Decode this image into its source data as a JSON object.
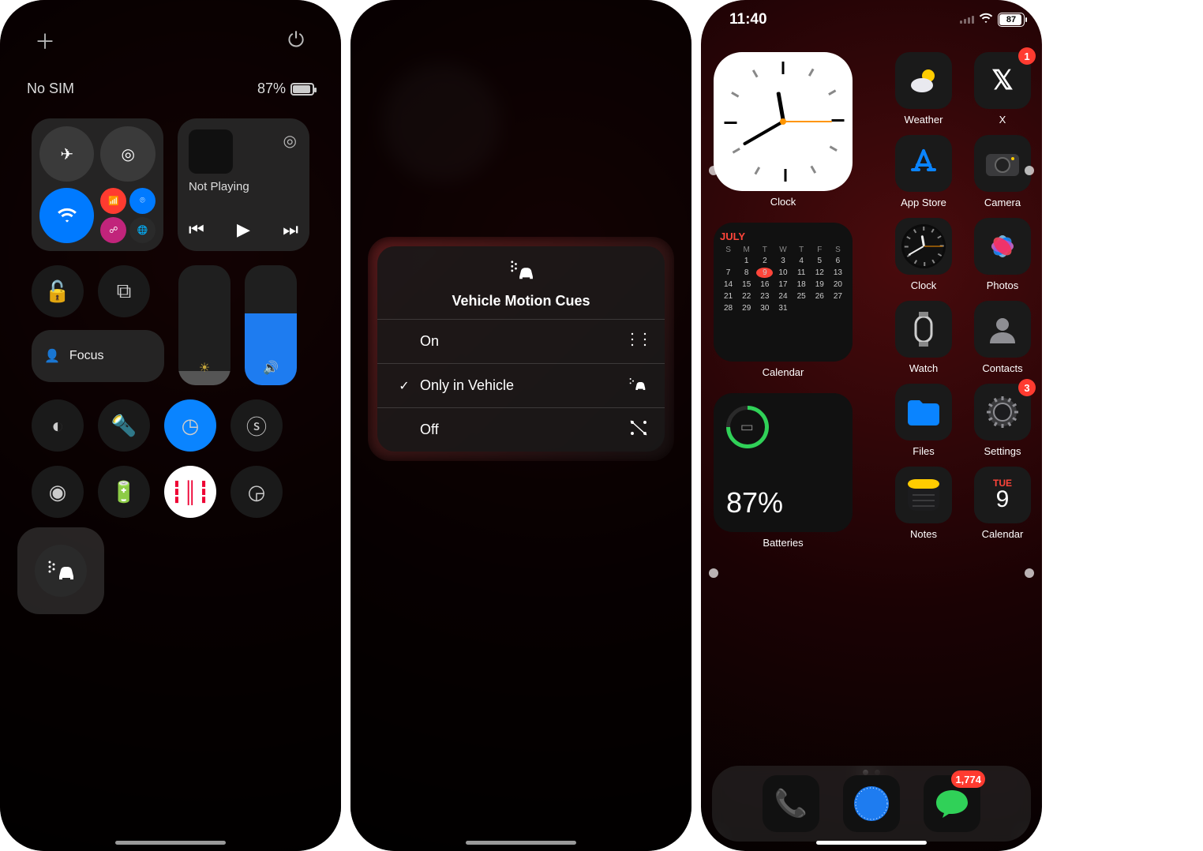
{
  "panel1": {
    "status": {
      "carrier": "No SIM",
      "battery_text": "87%"
    },
    "media": {
      "title": "Not Playing"
    },
    "focus_label": "Focus"
  },
  "panel2": {
    "menu_title": "Vehicle Motion Cues",
    "options": [
      {
        "label": "On",
        "selected": false
      },
      {
        "label": "Only in Vehicle",
        "selected": true
      },
      {
        "label": "Off",
        "selected": false
      }
    ]
  },
  "panel3": {
    "status": {
      "time": "11:40",
      "battery": "87"
    },
    "apps_mid": [
      {
        "label": "Weather",
        "badge": null
      },
      {
        "label": "App Store",
        "badge": null
      },
      {
        "label": "Clock",
        "badge": null
      },
      {
        "label": "Watch",
        "badge": null
      },
      {
        "label": "Files",
        "badge": null
      },
      {
        "label": "Notes",
        "badge": null
      }
    ],
    "apps_right": [
      {
        "label": "X",
        "badge": "1"
      },
      {
        "label": "Camera",
        "badge": null
      },
      {
        "label": "Photos",
        "badge": null
      },
      {
        "label": "Contacts",
        "badge": null
      },
      {
        "label": "Settings",
        "badge": "3"
      },
      {
        "label": "Calendar",
        "badge": null
      }
    ],
    "widgets": {
      "clock_label": "Clock",
      "calendar": {
        "label": "Calendar",
        "month": "JULY",
        "dow": [
          "S",
          "M",
          "T",
          "W",
          "T",
          "F",
          "S"
        ],
        "first_offset": 1,
        "today": 9,
        "last": 31
      },
      "battery": {
        "label": "Batteries",
        "percent": "87%"
      }
    },
    "calendar_icon": {
      "dow": "TUE",
      "day": "9"
    },
    "dock_badge": "1,774"
  }
}
